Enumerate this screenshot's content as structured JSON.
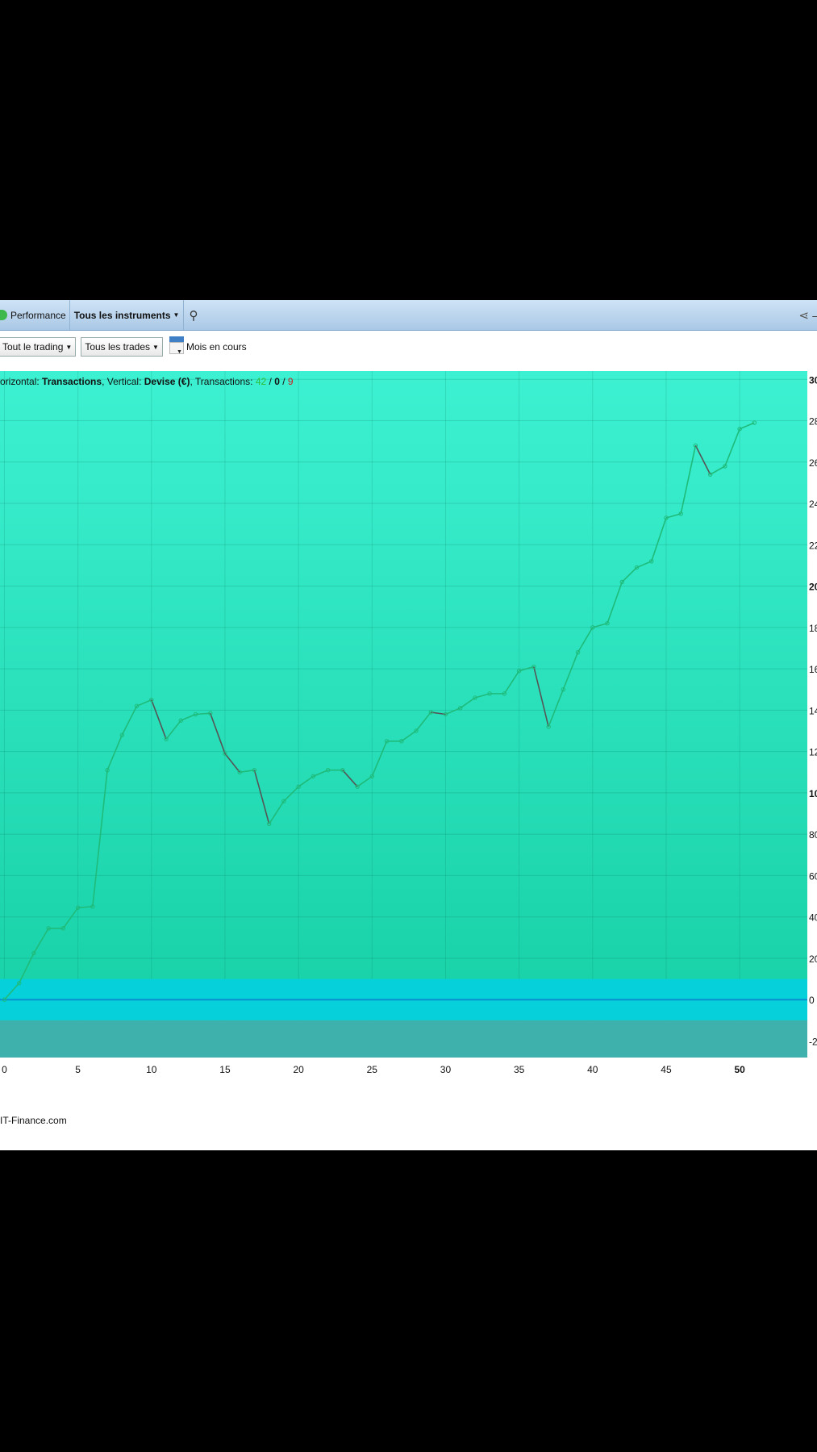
{
  "window": {
    "tab_performance": "Performance",
    "tab_instruments": "Tous les instruments",
    "wrench_icon": "wrench-icon",
    "share_icon": "share-icon",
    "minimize_icon": "minimize-icon"
  },
  "toolbar": {
    "trading_select": "Tout le trading",
    "trades_select": "Tous les trades",
    "calendar_icon": "calendar-icon",
    "period_label": "Mois en cours"
  },
  "chart_header": {
    "prefix": "orizontal: ",
    "horizontal": "Transactions",
    "mid": ", Vertical: ",
    "vertical": "Devise (€)",
    "mid2": ", Transactions: ",
    "count_win": "42",
    "sep1": " / ",
    "count_even": "0",
    "sep2": " / ",
    "count_loss": "9"
  },
  "watermark": "IT-Finance.com",
  "colors": {
    "bg_top": "#3cf1d1",
    "bg_bottom": "#16cfa4",
    "zero_band": "#06d0d9",
    "negative_zone": "#3fb1ad",
    "positive_line": "#1fbb7a",
    "negative_line": "#555555",
    "count_win": "#2fbf3a",
    "count_loss": "#cc2222",
    "zero_line": "#0a8fd0"
  },
  "chart_data": {
    "type": "line",
    "x": [
      0,
      1,
      2,
      3,
      4,
      5,
      6,
      7,
      8,
      9,
      10,
      11,
      12,
      13,
      14,
      15,
      16,
      17,
      18,
      19,
      20,
      21,
      22,
      23,
      24,
      25,
      26,
      27,
      28,
      29,
      30,
      31,
      32,
      33,
      34,
      35,
      36,
      37,
      38,
      39,
      40,
      41,
      42,
      43,
      44,
      45,
      46,
      47,
      48,
      49,
      50,
      51
    ],
    "y": [
      0,
      80,
      225,
      345,
      345,
      445,
      450,
      1110,
      1280,
      1420,
      1450,
      1260,
      1350,
      1380,
      1385,
      1190,
      1100,
      1110,
      850,
      960,
      1030,
      1080,
      1110,
      1110,
      1030,
      1080,
      1250,
      1250,
      1300,
      1390,
      1380,
      1410,
      1460,
      1480,
      1480,
      1590,
      1610,
      1320,
      1500,
      1680,
      1800,
      1820,
      2020,
      2090,
      2120,
      2330,
      2350,
      2680,
      2540,
      2580,
      2760,
      2790
    ],
    "xticks": [
      0,
      5,
      10,
      15,
      20,
      25,
      30,
      35,
      40,
      45,
      50
    ],
    "yticks": [
      -200,
      0,
      200,
      400,
      600,
      800,
      1000,
      1200,
      1400,
      1600,
      1800,
      2000,
      2200,
      2400,
      2600,
      2800,
      3000
    ],
    "ytick_labels": [
      "-2",
      "0",
      "20",
      "40",
      "60",
      "80",
      "10",
      "12",
      "14",
      "16",
      "18",
      "20",
      "22",
      "24",
      "26",
      "28",
      "30"
    ],
    "xlim": [
      -0.3,
      54.6
    ],
    "ylim": [
      -280,
      3040
    ],
    "grid": true,
    "legend": "none"
  }
}
